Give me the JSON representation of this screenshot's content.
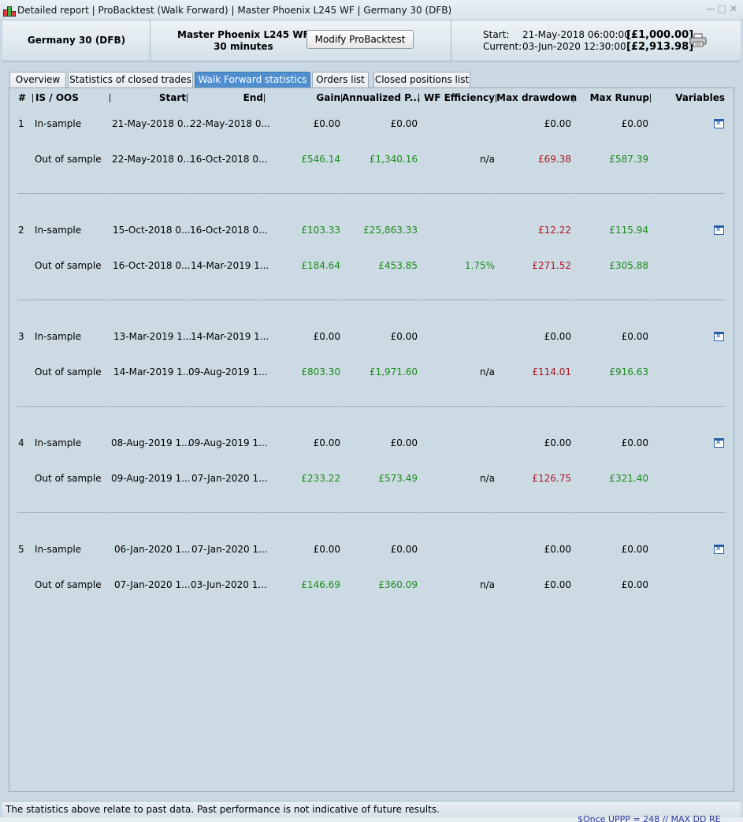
{
  "window": {
    "title_parts": [
      "Detailed report",
      "ProBacktest (Walk Forward)",
      "Master Phoenix L245 WF",
      "Germany 30 (DFB)"
    ],
    "title": "Detailed report | ProBacktest (Walk Forward) | Master Phoenix L245 WF | Germany 30 (DFB)",
    "controls": {
      "minimize": "—",
      "maximize": "□",
      "close": "✕"
    }
  },
  "header": {
    "instrument": "Germany 30 (DFB)",
    "strategy_name": "Master Phoenix L245 WF",
    "timeframe": "30 minutes",
    "modify_label": "Modify ProBacktest",
    "start_label": "Start:",
    "start_date": "21-May-2018 06:00:00",
    "start_value": "[£1,000.00]",
    "current_label": "Current:",
    "current_date": "03-Jun-2020 12:30:00",
    "current_value": "[£2,913.98]"
  },
  "tabs": [
    {
      "label": "Overview"
    },
    {
      "label": "Statistics of closed trades"
    },
    {
      "label": "Walk Forward statistics",
      "active": true
    },
    {
      "label": "Orders list"
    },
    {
      "label": "Closed positions list"
    }
  ],
  "table": {
    "columns": [
      "#",
      "IS / OOS",
      "Start",
      "End",
      "Gain",
      "Annualized P...",
      "WF Efficiency",
      "Max drawdown",
      "Max Runup",
      "Variables"
    ],
    "rows": [
      {
        "num": "1",
        "is": {
          "type": "In-sample",
          "start": "21-May-2018 0...",
          "end": "22-May-2018 0...",
          "gain": "£0.00",
          "ann": "£0.00",
          "wf": "",
          "dd": "£0.00",
          "runup": "£0.00"
        },
        "oos": {
          "type": "Out of sample",
          "start": "22-May-2018 0...",
          "end": "16-Oct-2018 0...",
          "gain": "£546.14",
          "ann": "£1,340.16",
          "wf": "n/a",
          "dd": "£69.38",
          "runup": "£587.39"
        }
      },
      {
        "num": "2",
        "is": {
          "type": "In-sample",
          "start": "15-Oct-2018 0...",
          "end": "16-Oct-2018 0...",
          "gain": "£103.33",
          "ann": "£25,863.33",
          "wf": "",
          "dd": "£12.22",
          "runup": "£115.94"
        },
        "oos": {
          "type": "Out of sample",
          "start": "16-Oct-2018 0...",
          "end": "14-Mar-2019 1...",
          "gain": "£184.64",
          "ann": "£453.85",
          "wf": "1.75%",
          "dd": "£271.52",
          "runup": "£305.88"
        }
      },
      {
        "num": "3",
        "is": {
          "type": "In-sample",
          "start": "13-Mar-2019 1...",
          "end": "14-Mar-2019 1...",
          "gain": "£0.00",
          "ann": "£0.00",
          "wf": "",
          "dd": "£0.00",
          "runup": "£0.00"
        },
        "oos": {
          "type": "Out of sample",
          "start": "14-Mar-2019 1...",
          "end": "09-Aug-2019 1...",
          "gain": "£803.30",
          "ann": "£1,971.60",
          "wf": "n/a",
          "dd": "£114.01",
          "runup": "£916.63"
        }
      },
      {
        "num": "4",
        "is": {
          "type": "In-sample",
          "start": "08-Aug-2019 1...",
          "end": "09-Aug-2019 1...",
          "gain": "£0.00",
          "ann": "£0.00",
          "wf": "",
          "dd": "£0.00",
          "runup": "£0.00"
        },
        "oos": {
          "type": "Out of sample",
          "start": "09-Aug-2019 1...",
          "end": "07-Jan-2020 1...",
          "gain": "£233.22",
          "ann": "£573.49",
          "wf": "n/a",
          "dd": "£126.75",
          "runup": "£321.40"
        }
      },
      {
        "num": "5",
        "is": {
          "type": "In-sample",
          "start": "06-Jan-2020 1...",
          "end": "07-Jan-2020 1...",
          "gain": "£0.00",
          "ann": "£0.00",
          "wf": "",
          "dd": "£0.00",
          "runup": "£0.00"
        },
        "oos": {
          "type": "Out of sample",
          "start": "07-Jan-2020 1...",
          "end": "03-Jun-2020 1...",
          "gain": "£146.69",
          "ann": "£360.09",
          "wf": "n/a",
          "dd": "£0.00",
          "runup": "£0.00"
        }
      }
    ]
  },
  "footer": {
    "disclaimer": "The statistics above relate to past data. Past performance is not indicative of future results."
  },
  "background_code": "$Once UPPP = 248 // MAX DD RE",
  "colors": {
    "positive": "#1c8c1c",
    "negative": "#b0161e",
    "active_tab": "#4f8fd0",
    "variables_icon": "#2b5ea8"
  },
  "icons": {
    "app": "candlestick-chart-icon",
    "print": "printer-icon",
    "variables": "variables-window-icon"
  }
}
